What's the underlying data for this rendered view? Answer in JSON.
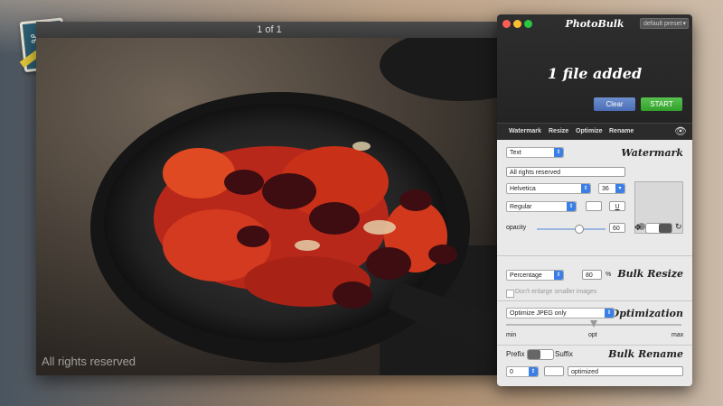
{
  "viewer": {
    "title": "1 of 1",
    "overlay_watermark": "All rights reserved"
  },
  "panel": {
    "brand": "PhotoBulk",
    "preset": "default preset",
    "status": "1 file added",
    "clear_label": "Clear",
    "start_label": "START",
    "tabs": [
      "Watermark",
      "Resize",
      "Optimize",
      "Rename"
    ],
    "watermark": {
      "title": "Watermark",
      "type": "Text",
      "text_value": "All rights reserved",
      "font": "Helvetica",
      "size": "36",
      "style": "Regular",
      "underline_label": "U",
      "opacity_label": "opacity",
      "opacity_value": "60",
      "opacity_fraction": 0.6
    },
    "resize": {
      "title": "Bulk Resize",
      "mode": "Percentage",
      "value": "80",
      "unit": "%",
      "dont_enlarge": "Don't enlarge smaller images"
    },
    "optimization": {
      "title": "Optimization",
      "mode": "Optimize JPEG only",
      "min_label": "min",
      "opt_label": "opt",
      "max_label": "max",
      "level_fraction": 0.5
    },
    "rename": {
      "title": "Bulk Rename",
      "prefix_label": "Prefix",
      "suffix_label": "Suffix",
      "number": "0",
      "name": "optimized"
    }
  },
  "colors": {
    "clear": "#4a6db6",
    "start": "#34a02c",
    "accent": "#3a7ee6"
  }
}
